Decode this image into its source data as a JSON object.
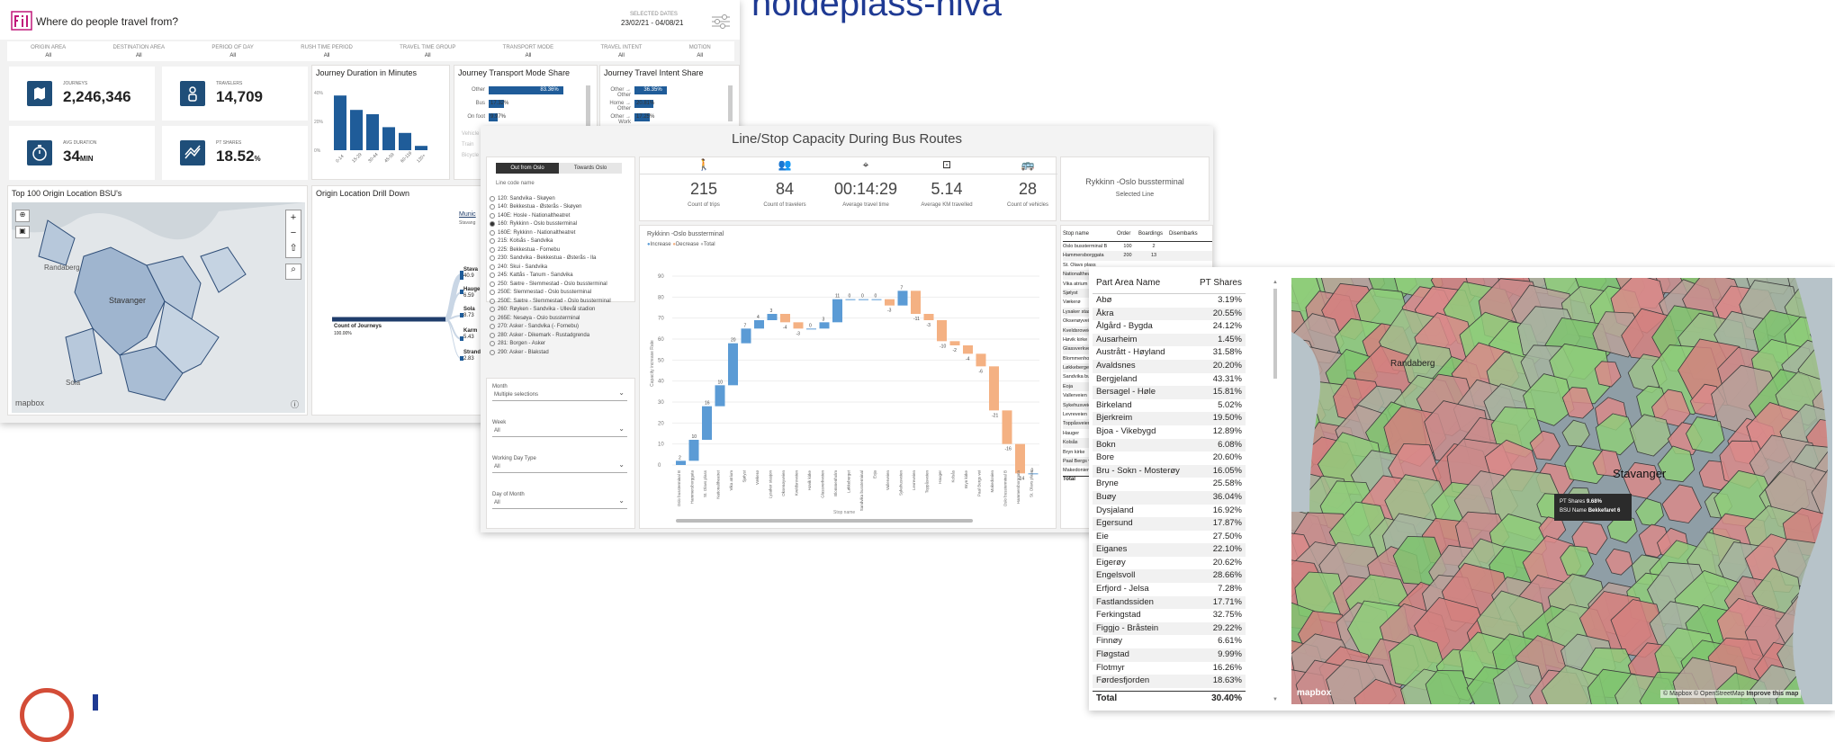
{
  "headline": "holdeplass-nivå",
  "dashboard1": {
    "title": "Where do people travel from?",
    "selected_dates_label": "SELECTED DATES",
    "selected_dates": "23/02/21 - 04/08/21",
    "filters": [
      {
        "label": "ORIGIN AREA",
        "value": "All"
      },
      {
        "label": "DESTINATION AREA",
        "value": "All"
      },
      {
        "label": "PERIOD OF DAY",
        "value": "All"
      },
      {
        "label": "RUSH TIME PERIOD",
        "value": "All"
      },
      {
        "label": "TRAVEL TIME GROUP",
        "value": "All"
      },
      {
        "label": "TRANSPORT MODE",
        "value": "All"
      },
      {
        "label": "TRAVEL INTENT",
        "value": "All"
      },
      {
        "label": "MOTION",
        "value": "All"
      }
    ],
    "kpis": {
      "journeys": {
        "label": "JOURNEYS",
        "value": "2,246,346"
      },
      "travelers": {
        "label": "TRAVELERS",
        "value": "14,709"
      },
      "avg_duration": {
        "label": "AVG DURATION",
        "value": "34",
        "unit": "MIN"
      },
      "pt_shares": {
        "label": "PT SHARES",
        "value": "18.52",
        "unit": "%"
      }
    },
    "duration_chart": {
      "title": "Journey Duration in Minutes",
      "y_ticks": [
        "40%",
        "20%",
        "0%"
      ],
      "categories": [
        "0-14",
        "15-29",
        "30-44",
        "45-59",
        "60-119",
        "120+"
      ],
      "values": [
        38,
        28,
        25,
        16,
        12,
        3
      ]
    },
    "mode_chart": {
      "title": "Journey Transport Mode Share",
      "rows": [
        {
          "label": "Other",
          "value_label": "83.36%",
          "value": 83.36
        },
        {
          "label": "Bus",
          "value_label": "17.32%",
          "value": 17.32
        },
        {
          "label": "On foot",
          "value_label": "9.97%",
          "value": 9.97
        }
      ],
      "faded_labels": [
        "Vehicle",
        "Train",
        "Bicycle"
      ]
    },
    "intent_chart": {
      "title": "Journey Travel Intent Share",
      "rows": [
        {
          "label": "Other → Other",
          "value_label": "36.35%",
          "value": 36.35
        },
        {
          "label": "Home → Other",
          "value_label": "20.81%",
          "value": 20.81
        },
        {
          "label": "Other → Work",
          "value_label": "17.25%",
          "value": 17.25
        }
      ]
    },
    "map_title": "Top 100 Origin Location BSU's",
    "map_label": "Stavanger",
    "map_place_1": "Randaberg",
    "map_place_2": "Sola",
    "map_brand": "mapbox",
    "drill_title": "Origin Location Drill Down",
    "drill_root_label": "Count of Journeys",
    "drill_root_value": "100.00%",
    "drill_column_title": "Munic",
    "drill_column_sub": "Stavang",
    "drill_items": [
      {
        "label": "Stava",
        "value": "40.9"
      },
      {
        "label": "Hauge",
        "value": "6.59"
      },
      {
        "label": "Sola",
        "value": "8.73"
      },
      {
        "label": "Karm",
        "value": "5.43"
      },
      {
        "label": "Strand",
        "value": "2.83"
      }
    ]
  },
  "dashboard2": {
    "title": "Line/Stop Capacity During Bus Routes",
    "tab_active": "Out from Oslo",
    "tab_inactive": "Towards Oslo",
    "line_list_label": "Line code name",
    "lines": [
      "120: Sandvika - Skøyen",
      "140: Bekkestua - Østerås - Skøyen",
      "140E: Hosle - Nationaltheatret",
      "160: Rykkinn - Oslo bussterminal",
      "160E: Rykkinn - Nationaltheatret",
      "215: Kolsås - Sandvika",
      "225: Bekkestua - Fornebu",
      "230: Sandvika - Bekkestua - Østerås - Ila",
      "240: Skui - Sandvika",
      "245: Kattås - Tanum - Sandvika",
      "250: Sætre - Slemmestad - Oslo bussterminal",
      "250E: Slemmestad - Oslo bussterminal",
      "250E: Sætre - Slemmestad - Oslo bussterminal",
      "260: Røyken - Sandvika - Ullevål stadion",
      "265E: Nesøya - Oslo bussterminal",
      "270: Asker - Sandvika (- Fornebu)",
      "280: Asker - Dikemark - Rustadgrenda",
      "281: Borgen - Asker",
      "290: Asker - Blakstad"
    ],
    "selected_line_index": 3,
    "slicers": [
      {
        "label": "Month",
        "value": "Multiple selections"
      },
      {
        "label": "Week",
        "value": "All"
      },
      {
        "label": "Working Day Type",
        "value": "All"
      },
      {
        "label": "Day of Month",
        "value": "All"
      }
    ],
    "stats": [
      {
        "icon": "walking-person-icon",
        "value": "215",
        "label": "Count of trips"
      },
      {
        "icon": "group-icon",
        "value": "84",
        "label": "Count of travelers"
      },
      {
        "icon": "route-pin-icon",
        "value": "00:14:29",
        "label": "Average travel time"
      },
      {
        "icon": "speedometer-icon",
        "value": "5.14",
        "label": "Average KM travelled"
      },
      {
        "icon": "bus-icon",
        "value": "28",
        "label": "Count of vehicles"
      }
    ],
    "selected_line_name": "Rykkinn -Oslo bussterminal",
    "selected_line_caption": "Selected Line",
    "waterfall": {
      "title": "Rykkinn -Oslo bussterminal",
      "legend": [
        "Increase",
        "Decrease",
        "Total"
      ],
      "y_axis_label": "Capacity increase Rate",
      "x_axis_label": "Stop name",
      "y_ticks": [
        "90",
        "80",
        "70",
        "60",
        "50",
        "40",
        "30",
        "20",
        "10",
        "0"
      ]
    },
    "stop_table": {
      "headers": [
        "Stop name",
        "Order",
        "Boardings",
        "Disembarks"
      ],
      "rows": [
        [
          "Oslo bussterminal B",
          "100",
          "2",
          ""
        ],
        [
          "Hammersborggata",
          "200",
          "13",
          ""
        ],
        [
          "St. Olavs plass",
          "",
          "",
          ""
        ],
        [
          "Nationaltheatret",
          "",
          "",
          ""
        ],
        [
          "Vika atrium",
          "",
          "",
          ""
        ],
        [
          "Sjølyst",
          "",
          "",
          ""
        ],
        [
          "Vækerø",
          "",
          "",
          ""
        ],
        [
          "Lysaker stasjon",
          "",
          "",
          ""
        ],
        [
          "Oksenøyveien",
          "",
          "",
          ""
        ],
        [
          "Kveldsroveien",
          "",
          "",
          ""
        ],
        [
          "Høvik kirke",
          "",
          "",
          ""
        ],
        [
          "Glassverkveien",
          "",
          "",
          ""
        ],
        [
          "Blommenholm",
          "",
          "",
          ""
        ],
        [
          "Løkkeberget",
          "",
          "",
          ""
        ],
        [
          "Sandvika bussterminal",
          "",
          "",
          ""
        ],
        [
          "Eoja",
          "",
          "",
          ""
        ],
        [
          "Vallerveien",
          "",
          "",
          ""
        ],
        [
          "Sykehusveien",
          "",
          "",
          ""
        ],
        [
          "Levreveien",
          "",
          "",
          ""
        ],
        [
          "Toppåsveien",
          "",
          "",
          ""
        ],
        [
          "Hauger",
          "",
          "",
          ""
        ],
        [
          "Kolsås",
          "",
          "",
          ""
        ],
        [
          "Bryn kirke",
          "",
          "",
          ""
        ],
        [
          "Paal Bergs vei",
          "",
          "",
          ""
        ],
        [
          "Makedonien",
          "",
          "",
          ""
        ]
      ],
      "total_label": "Total"
    }
  },
  "dashboard3": {
    "table_headers": [
      "Part Area Name",
      "PT Shares"
    ],
    "rows": [
      [
        "Abø",
        "3.19%"
      ],
      [
        "Åkra",
        "20.55%"
      ],
      [
        "Ålgård - Bygda",
        "24.12%"
      ],
      [
        "Ausarheim",
        "1.45%"
      ],
      [
        "Austrått - Høyland",
        "31.58%"
      ],
      [
        "Avaldsnes",
        "20.20%"
      ],
      [
        "Bergjeland",
        "43.31%"
      ],
      [
        "Bersagel - Høle",
        "15.81%"
      ],
      [
        "Birkeland",
        "5.02%"
      ],
      [
        "Bjerkreim",
        "19.50%"
      ],
      [
        "Bjoa - Vikebygd",
        "12.89%"
      ],
      [
        "Bokn",
        "6.08%"
      ],
      [
        "Bore",
        "20.60%"
      ],
      [
        "Bru - Sokn - Mosterøy",
        "16.05%"
      ],
      [
        "Bryne",
        "25.58%"
      ],
      [
        "Buøy",
        "36.04%"
      ],
      [
        "Dysjaland",
        "16.92%"
      ],
      [
        "Egersund",
        "17.87%"
      ],
      [
        "Eie",
        "27.50%"
      ],
      [
        "Eiganes",
        "22.10%"
      ],
      [
        "Eigerøy",
        "20.62%"
      ],
      [
        "Engelsvoll",
        "28.66%"
      ],
      [
        "Erfjord - Jelsa",
        "7.28%"
      ],
      [
        "Fastlandssiden",
        "17.71%"
      ],
      [
        "Ferkingstad",
        "32.75%"
      ],
      [
        "Figgjo - Bråstein",
        "29.22%"
      ],
      [
        "Finnøy",
        "6.61%"
      ],
      [
        "Fløgstad",
        "9.99%"
      ],
      [
        "Flotmyr",
        "16.26%"
      ],
      [
        "Førdesfjorden",
        "18.63%"
      ]
    ],
    "total_label": "Total",
    "total_value": "30.40%",
    "map_city": "Stavanger",
    "map_place": "Randaberg",
    "tooltip_l1_label": "PT Shares",
    "tooltip_l1_value": "9.68%",
    "tooltip_l2_label": "BSU Name",
    "tooltip_l2_value": "Bekkefaret 6",
    "map_brand": "mapbox",
    "attribution": "© Mapbox © OpenStreetMap",
    "improve_link": "Improve this map"
  },
  "colors": {
    "primary_blue": "#1f5c99",
    "waterfall_increase": "#5b9bd5",
    "waterfall_decrease": "#f4b183",
    "headline": "#1f3a93",
    "logo_ring": "#d34c37"
  }
}
